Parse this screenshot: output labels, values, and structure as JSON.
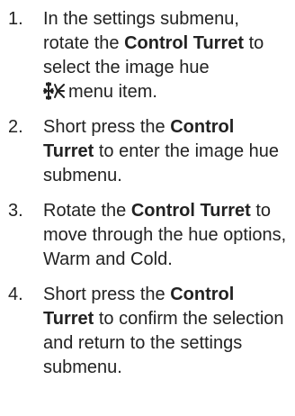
{
  "steps": [
    {
      "number": "1.",
      "parts": {
        "a": "In the settings submenu, rotate the ",
        "b": "Control Turret",
        "c": " to select the image hue",
        "d": "menu item."
      },
      "icon": "image-hue-icon"
    },
    {
      "number": "2.",
      "parts": {
        "a": "Short press the ",
        "b": "Control Turret",
        "c": " to enter the image hue submenu."
      }
    },
    {
      "number": "3.",
      "parts": {
        "a": "Rotate the ",
        "b": "Control Turret",
        "c": " to move through the hue options, Warm and Cold."
      }
    },
    {
      "number": "4.",
      "parts": {
        "a": "Short press the ",
        "b": "Control Turret",
        "c": " to confirm the selection and return to the settings submenu."
      }
    }
  ]
}
